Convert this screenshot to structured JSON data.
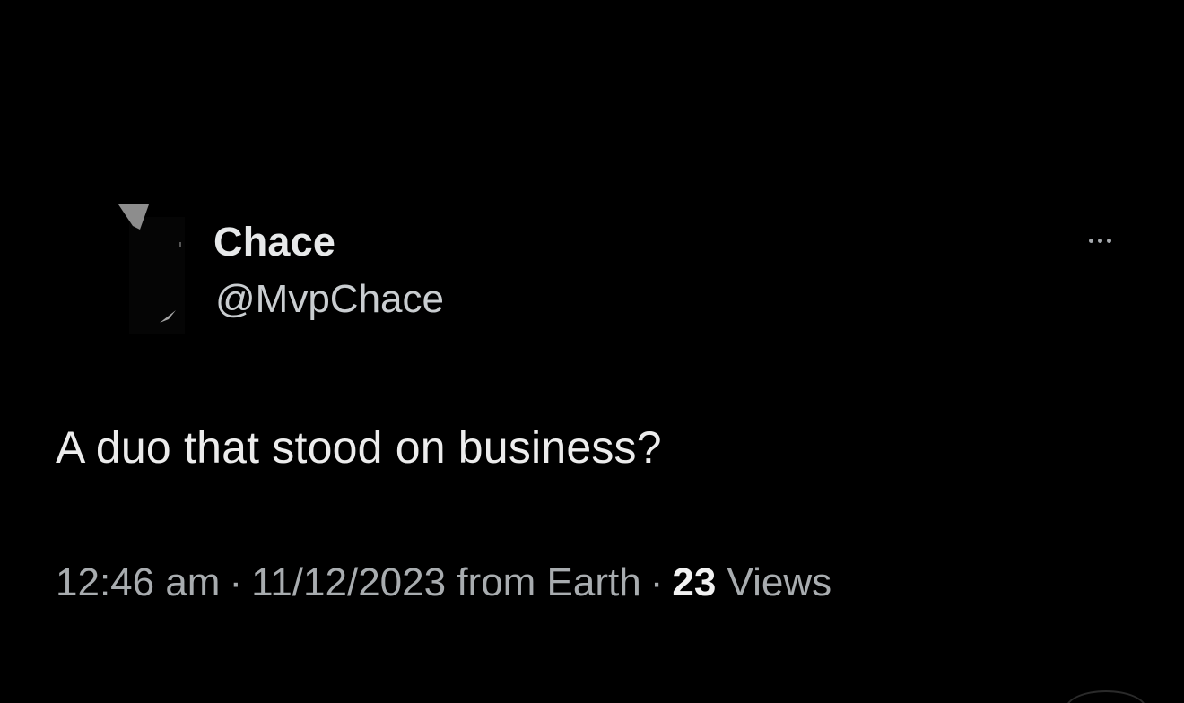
{
  "tweet": {
    "author": {
      "display_name": "Chace",
      "handle": "@MvpChace",
      "avatar_icon": "profile-avatar"
    },
    "more_icon": "ellipsis-icon",
    "text": "A duo that stood on business?",
    "meta": {
      "time": "12:46 am",
      "separator": "·",
      "date": "11/12/2023",
      "source": "from Earth",
      "views_count": "23",
      "views_label": "Views"
    }
  },
  "colors": {
    "background": "#000000",
    "primary_text": "#e7e9ea",
    "secondary_text": "#a8acaf"
  }
}
